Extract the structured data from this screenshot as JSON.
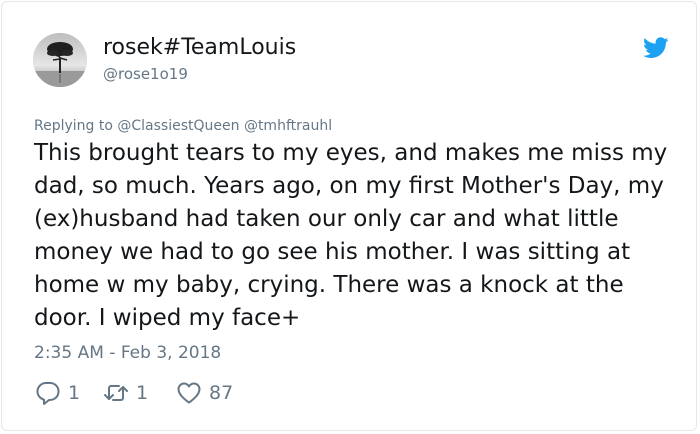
{
  "tweet": {
    "display_name": "rosek#TeamLouis",
    "handle": "@rose1o19",
    "replying_to": "Replying to @ClassiestQueen @tmhftrauhl",
    "text": "This brought tears to my eyes, and makes me miss my dad, so much. Years ago, on my first Mother's Day, my (ex)husband had taken our only car and what little money we had to go see his mother. I was sitting at home w my baby, crying. There was a knock at the door. I wiped my face+",
    "timestamp": "2:35 AM - Feb 3, 2018"
  },
  "actions": {
    "replies": "1",
    "retweets": "1",
    "likes": "87"
  },
  "icons": {
    "brand": "twitter-bird-icon",
    "reply": "reply-bubble-icon",
    "retweet": "retweet-icon",
    "like": "heart-icon"
  },
  "colors": {
    "brand_blue": "#1da1f2",
    "text": "#14171a",
    "muted": "#657786",
    "border": "#e1e8ed"
  }
}
